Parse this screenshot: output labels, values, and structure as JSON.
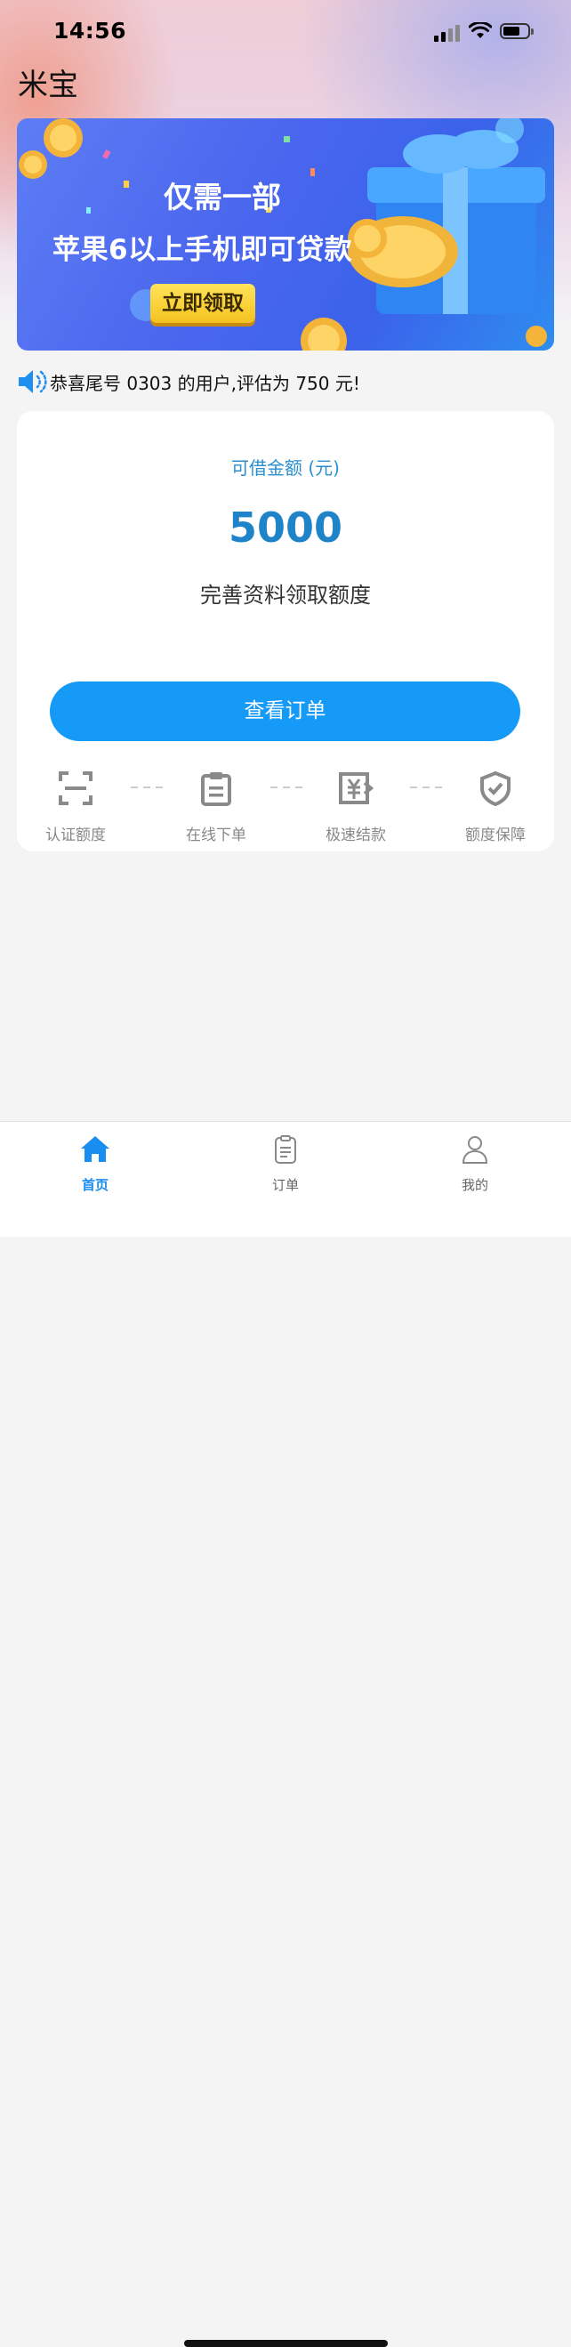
{
  "status_bar": {
    "time": "14:56"
  },
  "app": {
    "title": "米宝"
  },
  "banner": {
    "line1": "仅需一部",
    "line2": "苹果6以上手机即可贷款",
    "cta": "立即领取"
  },
  "notice": {
    "text": "恭喜尾号 0303 的用户,评估为 750 元!"
  },
  "card": {
    "label": "可借金额 (元)",
    "amount": "5000",
    "subtitle": "完善资料领取额度",
    "button": "查看订单",
    "steps": [
      {
        "label": "认证额度",
        "icon": "scan-icon"
      },
      {
        "label": "在线下单",
        "icon": "clipboard-icon"
      },
      {
        "label": "极速结款",
        "icon": "yuan-transfer-icon"
      },
      {
        "label": "额度保障",
        "icon": "shield-check-icon"
      }
    ]
  },
  "tabbar": {
    "items": [
      {
        "label": "首页",
        "icon": "home-icon",
        "active": true
      },
      {
        "label": "订单",
        "icon": "order-icon",
        "active": false
      },
      {
        "label": "我的",
        "icon": "user-icon",
        "active": false
      }
    ]
  },
  "colors": {
    "accent": "#159bf7",
    "amount": "#1e83c8",
    "tab_active": "#1a8df0"
  }
}
